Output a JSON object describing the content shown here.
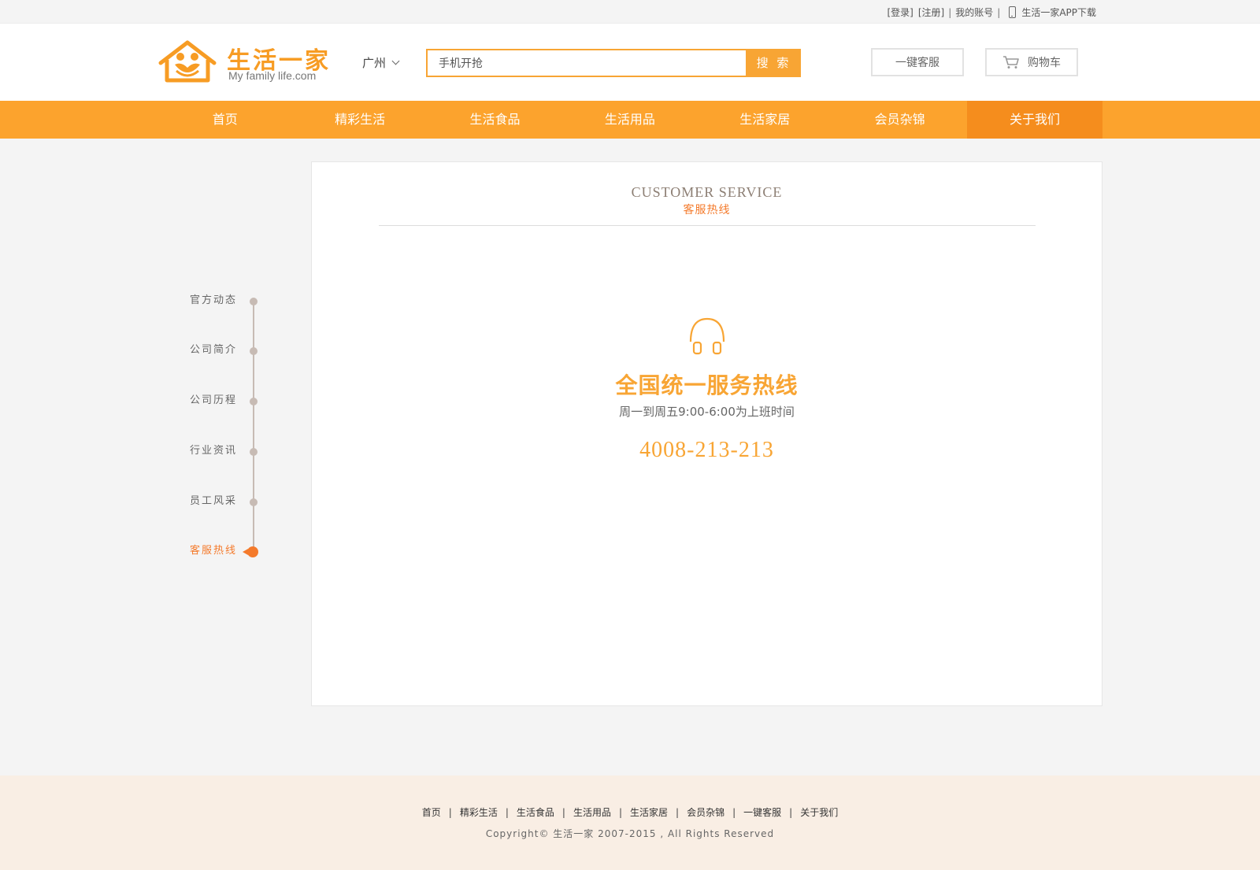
{
  "topbar": {
    "login": "[登录]",
    "register": "[注册]",
    "sep1": "|",
    "account": "我的账号",
    "sep2": "|",
    "app_download": "生活一家APP下载"
  },
  "header": {
    "logo_text": "生活一家",
    "logo_subtext": "My family life.com",
    "city": "广州",
    "search_value": "手机开抢",
    "search_button": "搜 索",
    "service_button": "一键客服",
    "cart_button": "购物车"
  },
  "nav": {
    "items": [
      {
        "label": "首页"
      },
      {
        "label": "精彩生活"
      },
      {
        "label": "生活食品"
      },
      {
        "label": "生活用品"
      },
      {
        "label": "生活家居"
      },
      {
        "label": "会员杂锦"
      },
      {
        "label": "关于我们",
        "active": true
      }
    ]
  },
  "sidebar": {
    "items": [
      {
        "label": "官方动态"
      },
      {
        "label": "公司简介"
      },
      {
        "label": "公司历程"
      },
      {
        "label": "行业资讯"
      },
      {
        "label": "员工风采"
      },
      {
        "label": "客服热线",
        "active": true
      }
    ]
  },
  "panel": {
    "title_en": "CUSTOMER SERVICE",
    "title_cn": "客服热线",
    "hotline_title": "全国统一服务热线",
    "hotline_hours": "周一到周五9:00-6:00为上班时间",
    "hotline_number": "4008-213-213"
  },
  "footer": {
    "links": [
      "首页",
      "精彩生活",
      "生活食品",
      "生活用品",
      "生活家居",
      "会员杂锦",
      "一键客服",
      "关于我们"
    ],
    "separator": "|",
    "copyright": "Copyright© 生活一家 2007-2015 , All Rights Reserved"
  },
  "colors": {
    "accent": "#fca32d",
    "accent_dark": "#f58d1d",
    "highlight": "#f47a2b",
    "footer_bg": "#f9eee4"
  }
}
